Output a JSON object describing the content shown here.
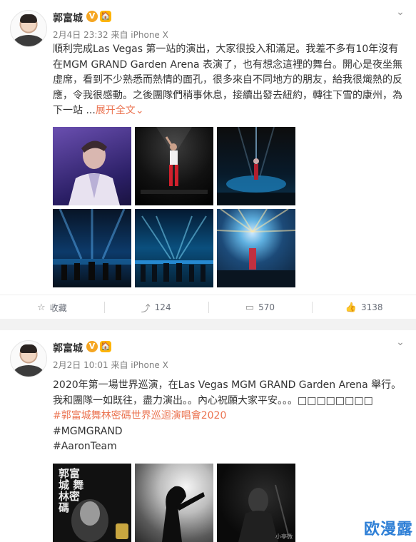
{
  "post1": {
    "user": {
      "name": "郭富城",
      "badge_v": "V",
      "badge_extra": "🏠"
    },
    "meta": "2月4日 23:32 来自 iPhone X",
    "text_body": "順利完成Las Vegas 第一站的演出，大家很投入和滿足。我差不多有10年沒有在MGM GRAND Garden Arena 表演了，也有想念這裡的舞台。開心是夜坐無虛席，看到不少熟悉而熱情的面孔，很多來自不同地方的朋友，給我很熾熱的反應，令我很感動。之後團隊們稍事休息，接續出發去紐約，轉往下雪的康州，為下一站 ...",
    "expand": "展开全文",
    "expand_arrow": "⌄",
    "more_icon": "⌄",
    "actions": {
      "fav": {
        "icon": "☆",
        "label": "收藏"
      },
      "repost": {
        "icon": "⤴",
        "label": "124"
      },
      "comment": {
        "icon": "▭",
        "label": "570"
      },
      "like": {
        "icon": "👍",
        "label": "3138"
      }
    }
  },
  "post2": {
    "user": {
      "name": "郭富城",
      "badge_v": "V",
      "badge_extra": "🏠"
    },
    "meta": "2月2日 10:01 来自 iPhone X",
    "more_icon": "⌄",
    "text_body": "2020年第一場世界巡演，在Las Vegas MGM GRAND Garden Arena 舉行。我和團隊一如既往，盡力演出。。內心祝願大家平安。。。□□□□□□□□",
    "tags": [
      "#郭富城舞林密碼世界巡迴演唱會2020",
      "#MGMGRAND",
      "#AaronTeam"
    ],
    "poster_text": "郭富城 舞林密碼",
    "photo_credit": "小亭微"
  },
  "watermark": "欧漫露"
}
